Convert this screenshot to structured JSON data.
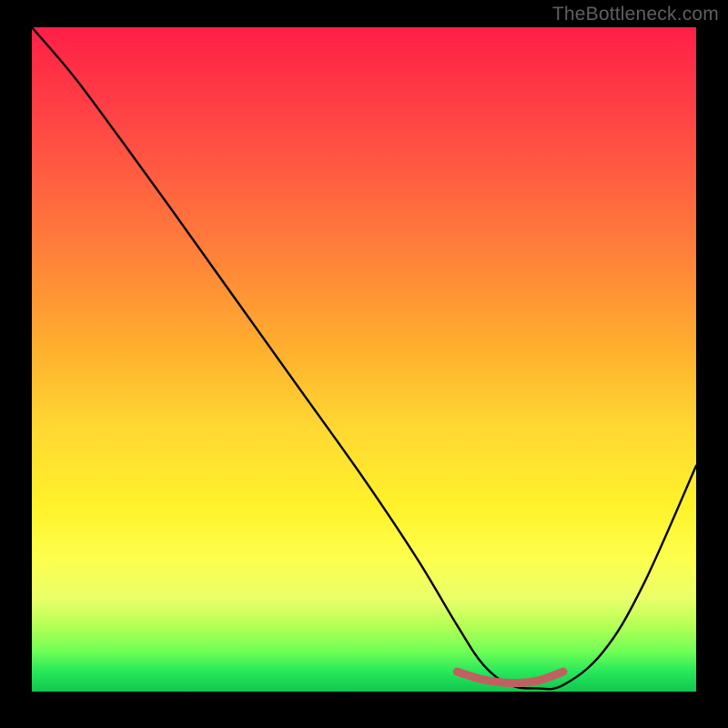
{
  "watermark": "TheBottleneck.com",
  "colors": {
    "frame": "#000000",
    "gradient_top": "#ff1f47",
    "gradient_bottom": "#11c64e",
    "curve": "#000000",
    "valley_highlight": "#c16060"
  },
  "chart_data": {
    "type": "line",
    "title": "",
    "xlabel": "",
    "ylabel": "",
    "xlim": [
      0,
      100
    ],
    "ylim": [
      0,
      100
    ],
    "series": [
      {
        "name": "bottleneck-curve",
        "x": [
          0,
          6,
          12,
          20,
          30,
          40,
          50,
          58,
          64,
          68,
          72,
          76,
          80,
          86,
          92,
          100
        ],
        "y": [
          100,
          93,
          85,
          74,
          60,
          46,
          32,
          20,
          10,
          4,
          1,
          0.5,
          1,
          6,
          16,
          34
        ]
      }
    ],
    "valley_segment": {
      "name": "optimal-range",
      "x": [
        64,
        68,
        72,
        76,
        80
      ],
      "y": [
        3.0,
        1.8,
        1.3,
        1.6,
        3.0
      ]
    },
    "annotations": []
  }
}
